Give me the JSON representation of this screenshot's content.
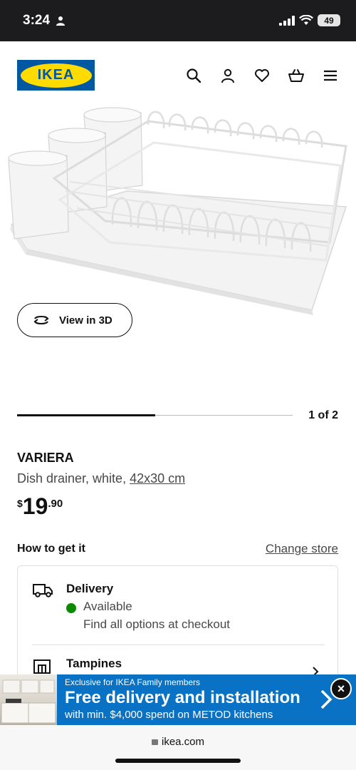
{
  "status_bar": {
    "time": "3:24",
    "battery": "49"
  },
  "header": {
    "logo_text": "IKEA",
    "icons": [
      "search-icon",
      "account-icon",
      "favourites-heart-icon",
      "shopping-bag-icon",
      "hamburger-menu-icon"
    ]
  },
  "gallery": {
    "view_3d_label": "View in 3D",
    "pager_text": "1 of 2",
    "progress": 0.5
  },
  "product": {
    "name": "VARIERA",
    "description": "Dish drainer, white, ",
    "size_link": "42x30 cm",
    "price_currency": "$",
    "price_integer": "19",
    "price_decimal": ".90"
  },
  "fulfilment": {
    "title": "How to get it",
    "change_store": "Change store",
    "delivery_title": "Delivery",
    "availability": "Available",
    "availability_color": "#0a8a00",
    "options_text": "Find all options at checkout",
    "store_name": "Tampines"
  },
  "banner": {
    "small": "Exclusive for IKEA Family members",
    "headline": "Free delivery and installation",
    "subline": "with min. $4,000 spend on METOD kitchens",
    "close": "×",
    "color": "#0a72c4"
  },
  "browser": {
    "url": "ikea.com"
  },
  "colors": {
    "brand_blue": "#0058a3",
    "brand_yellow": "#ffdb00"
  }
}
